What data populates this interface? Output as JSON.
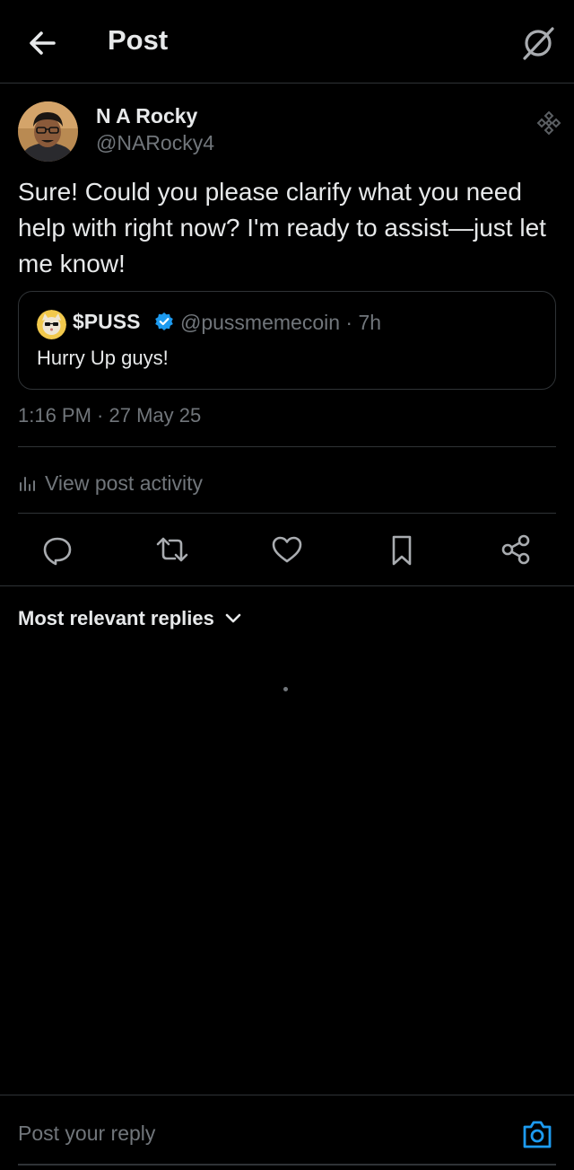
{
  "header": {
    "title": "Post",
    "back_icon": "arrow-left-icon",
    "grok_icon": "grok-icon"
  },
  "post": {
    "author_name": "N A Rocky",
    "author_handle": "@NARocky4",
    "text": "Sure! Could you please clarify what you need help with right now? I'm ready to assist—just let me know!",
    "timestamp": "1:16 PM · 27 May 25",
    "badge_icon": "diamond-icon"
  },
  "quote": {
    "name": "$PUSS",
    "verified": true,
    "handle_time": "@pussmemecoin · 7h",
    "text": "Hurry Up guys!"
  },
  "activity": {
    "label": "View post activity",
    "icon": "bar-chart-icon"
  },
  "actions": [
    "reply-icon",
    "repost-icon",
    "like-icon",
    "bookmark-icon",
    "share-icon"
  ],
  "replies": {
    "filter_label": "Most relevant replies"
  },
  "composer": {
    "placeholder": "Post your reply",
    "camera_icon": "camera-icon"
  },
  "colors": {
    "background": "#000000",
    "text_primary": "#e7e9ea",
    "text_secondary": "#71767b",
    "divider": "#2f3336",
    "accent": "#1d9bf0"
  }
}
